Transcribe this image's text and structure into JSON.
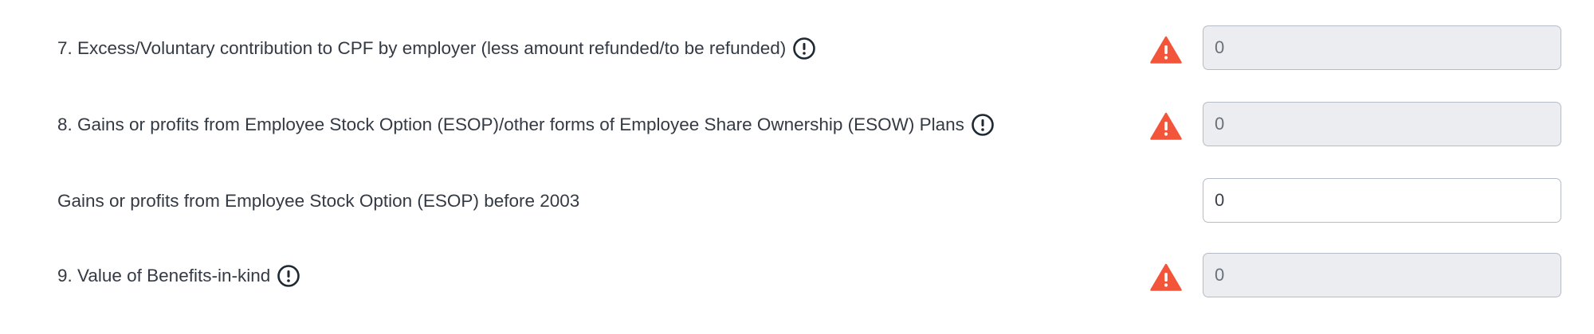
{
  "colors": {
    "warning": "#f2553a",
    "info_icon": "#1f2933",
    "field_border": "#b6bcc6",
    "field_disabled_bg": "#ebedf0",
    "label_text": "#333a44"
  },
  "rows": [
    {
      "label": "7. Excess/Voluntary contribution to CPF by employer (less amount refunded/to be refunded)",
      "info_icon": "info-exclamation-icon",
      "warning_icon": "warning-triangle-icon",
      "value": "0",
      "disabled": true
    },
    {
      "label": "8. Gains or profits from Employee Stock Option (ESOP)/other forms of Employee Share Ownership (ESOW) Plans",
      "info_icon": "info-exclamation-icon",
      "warning_icon": "warning-triangle-icon",
      "value": "0",
      "disabled": true
    },
    {
      "label": "Gains or profits from Employee Stock Option (ESOP) before 2003",
      "value": "0",
      "disabled": false
    },
    {
      "label": "9. Value of Benefits-in-kind",
      "info_icon": "info-exclamation-icon",
      "warning_icon": "warning-triangle-icon",
      "value": "0",
      "disabled": true
    }
  ]
}
